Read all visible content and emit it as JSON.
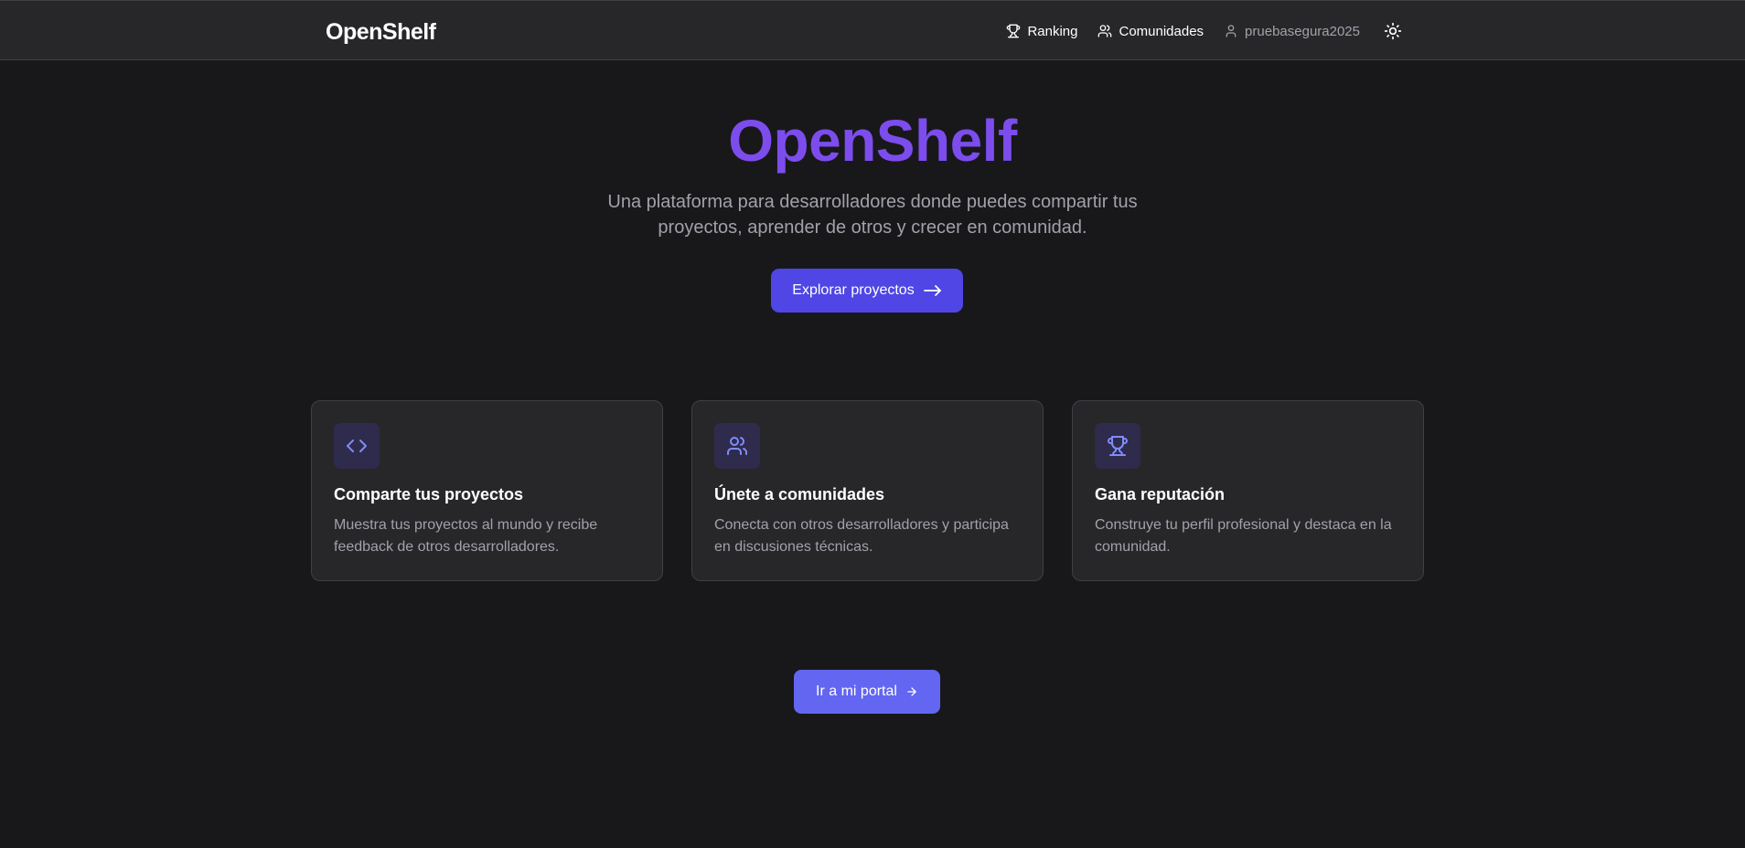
{
  "nav": {
    "brand": "OpenShelf",
    "ranking_label": "Ranking",
    "communities_label": "Comunidades",
    "username": "pruebasegura2025",
    "icons": [
      "trophy-icon",
      "users-icon",
      "user-icon",
      "sun-icon"
    ]
  },
  "hero": {
    "title": "OpenShelf",
    "subtitle": "Una plataforma para desarrolladores donde puedes compartir tus proyectos, aprender de otros y crecer en comunidad.",
    "cta_label": "Explorar proyectos"
  },
  "features": [
    {
      "icon": "code-icon",
      "title": "Comparte tus proyectos",
      "description": "Muestra tus proyectos al mundo y recibe feedback de otros desarrolladores."
    },
    {
      "icon": "users-icon",
      "title": "Únete a comunidades",
      "description": "Conecta con otros desarrolladores y participa en discusiones técnicas."
    },
    {
      "icon": "trophy-icon",
      "title": "Gana reputación",
      "description": "Construye tu perfil profesional y destaca en la comunidad."
    }
  ],
  "portal": {
    "label": "Ir a mi portal"
  },
  "colors": {
    "background": "#18181b",
    "navbar": "#27272a",
    "accent_title": "#7c4dec",
    "primary_button": "#4f46e5",
    "portal_button": "#6366f1",
    "icon_tint": "#818cf8"
  }
}
